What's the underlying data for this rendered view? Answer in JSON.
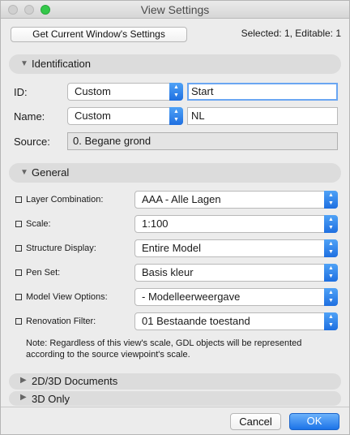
{
  "window": {
    "title": "View Settings"
  },
  "toolbar": {
    "get_settings_label": "Get Current Window's Settings",
    "selection_info": "Selected: 1, Editable: 1"
  },
  "identification": {
    "section_label": "Identification",
    "id_label": "ID:",
    "id_mode": "Custom",
    "id_value": "Start",
    "name_label": "Name:",
    "name_mode": "Custom",
    "name_value": "NL",
    "source_label": "Source:",
    "source_value": "0. Begane grond"
  },
  "general": {
    "section_label": "General",
    "rows": [
      {
        "label": "Layer Combination:",
        "value": "AAA - Alle Lagen",
        "icon": "layers-icon"
      },
      {
        "label": "Scale:",
        "value": "1:100",
        "icon": "scale-icon"
      },
      {
        "label": "Structure Display:",
        "value": "Entire Model",
        "icon": "structure-icon"
      },
      {
        "label": "Pen Set:",
        "value": "Basis kleur",
        "icon": "pen-icon"
      },
      {
        "label": "Model View Options:",
        "value": "- Modelleerweergave",
        "icon": "model-view-icon"
      },
      {
        "label": "Renovation Filter:",
        "value": "01 Bestaande toestand",
        "icon": "renovation-icon"
      }
    ],
    "note": "Note: Regardless of this view's scale, GDL objects will be represented according to the source viewpoint's scale."
  },
  "collapsed_sections": [
    "2D/3D Documents",
    "3D Only"
  ],
  "footer": {
    "cancel_label": "Cancel",
    "ok_label": "OK"
  },
  "colors": {
    "accent": "#1e6fe0",
    "focus_ring": "#6aa6f2"
  }
}
